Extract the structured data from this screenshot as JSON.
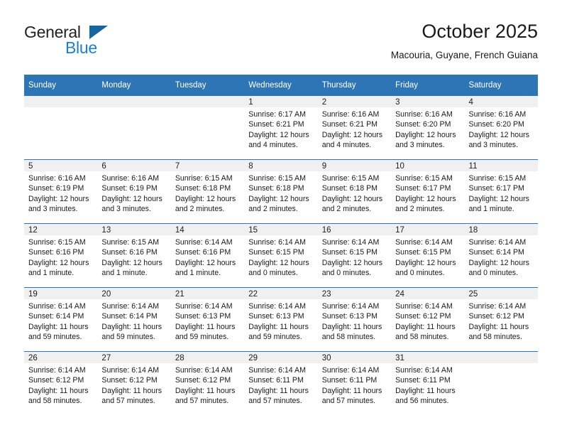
{
  "logo": {
    "primary_text": "General",
    "secondary_text": "Blue",
    "primary_color": "#231f20",
    "secondary_color": "#1b7fd4",
    "triangle_color": "#15659f"
  },
  "header": {
    "title": "October 2025",
    "subtitle": "Macouria, Guyane, French Guiana"
  },
  "theme": {
    "header_bg": "#2e75b6",
    "header_text": "#ffffff",
    "daynum_band_bg": "#f0f0f0",
    "grid_line": "#2e75b6"
  },
  "calendar": {
    "weekday_headers": [
      "Sunday",
      "Monday",
      "Tuesday",
      "Wednesday",
      "Thursday",
      "Friday",
      "Saturday"
    ],
    "weeks": [
      [
        {
          "day": "",
          "empty": true
        },
        {
          "day": "",
          "empty": true
        },
        {
          "day": "",
          "empty": true
        },
        {
          "day": "1",
          "sunrise": "Sunrise: 6:17 AM",
          "sunset": "Sunset: 6:21 PM",
          "daylight_line1": "Daylight: 12 hours",
          "daylight_line2": "and 4 minutes."
        },
        {
          "day": "2",
          "sunrise": "Sunrise: 6:16 AM",
          "sunset": "Sunset: 6:21 PM",
          "daylight_line1": "Daylight: 12 hours",
          "daylight_line2": "and 4 minutes."
        },
        {
          "day": "3",
          "sunrise": "Sunrise: 6:16 AM",
          "sunset": "Sunset: 6:20 PM",
          "daylight_line1": "Daylight: 12 hours",
          "daylight_line2": "and 3 minutes."
        },
        {
          "day": "4",
          "sunrise": "Sunrise: 6:16 AM",
          "sunset": "Sunset: 6:20 PM",
          "daylight_line1": "Daylight: 12 hours",
          "daylight_line2": "and 3 minutes."
        }
      ],
      [
        {
          "day": "5",
          "sunrise": "Sunrise: 6:16 AM",
          "sunset": "Sunset: 6:19 PM",
          "daylight_line1": "Daylight: 12 hours",
          "daylight_line2": "and 3 minutes."
        },
        {
          "day": "6",
          "sunrise": "Sunrise: 6:16 AM",
          "sunset": "Sunset: 6:19 PM",
          "daylight_line1": "Daylight: 12 hours",
          "daylight_line2": "and 3 minutes."
        },
        {
          "day": "7",
          "sunrise": "Sunrise: 6:15 AM",
          "sunset": "Sunset: 6:18 PM",
          "daylight_line1": "Daylight: 12 hours",
          "daylight_line2": "and 2 minutes."
        },
        {
          "day": "8",
          "sunrise": "Sunrise: 6:15 AM",
          "sunset": "Sunset: 6:18 PM",
          "daylight_line1": "Daylight: 12 hours",
          "daylight_line2": "and 2 minutes."
        },
        {
          "day": "9",
          "sunrise": "Sunrise: 6:15 AM",
          "sunset": "Sunset: 6:18 PM",
          "daylight_line1": "Daylight: 12 hours",
          "daylight_line2": "and 2 minutes."
        },
        {
          "day": "10",
          "sunrise": "Sunrise: 6:15 AM",
          "sunset": "Sunset: 6:17 PM",
          "daylight_line1": "Daylight: 12 hours",
          "daylight_line2": "and 2 minutes."
        },
        {
          "day": "11",
          "sunrise": "Sunrise: 6:15 AM",
          "sunset": "Sunset: 6:17 PM",
          "daylight_line1": "Daylight: 12 hours",
          "daylight_line2": "and 1 minute."
        }
      ],
      [
        {
          "day": "12",
          "sunrise": "Sunrise: 6:15 AM",
          "sunset": "Sunset: 6:16 PM",
          "daylight_line1": "Daylight: 12 hours",
          "daylight_line2": "and 1 minute."
        },
        {
          "day": "13",
          "sunrise": "Sunrise: 6:15 AM",
          "sunset": "Sunset: 6:16 PM",
          "daylight_line1": "Daylight: 12 hours",
          "daylight_line2": "and 1 minute."
        },
        {
          "day": "14",
          "sunrise": "Sunrise: 6:14 AM",
          "sunset": "Sunset: 6:16 PM",
          "daylight_line1": "Daylight: 12 hours",
          "daylight_line2": "and 1 minute."
        },
        {
          "day": "15",
          "sunrise": "Sunrise: 6:14 AM",
          "sunset": "Sunset: 6:15 PM",
          "daylight_line1": "Daylight: 12 hours",
          "daylight_line2": "and 0 minutes."
        },
        {
          "day": "16",
          "sunrise": "Sunrise: 6:14 AM",
          "sunset": "Sunset: 6:15 PM",
          "daylight_line1": "Daylight: 12 hours",
          "daylight_line2": "and 0 minutes."
        },
        {
          "day": "17",
          "sunrise": "Sunrise: 6:14 AM",
          "sunset": "Sunset: 6:15 PM",
          "daylight_line1": "Daylight: 12 hours",
          "daylight_line2": "and 0 minutes."
        },
        {
          "day": "18",
          "sunrise": "Sunrise: 6:14 AM",
          "sunset": "Sunset: 6:14 PM",
          "daylight_line1": "Daylight: 12 hours",
          "daylight_line2": "and 0 minutes."
        }
      ],
      [
        {
          "day": "19",
          "sunrise": "Sunrise: 6:14 AM",
          "sunset": "Sunset: 6:14 PM",
          "daylight_line1": "Daylight: 11 hours",
          "daylight_line2": "and 59 minutes."
        },
        {
          "day": "20",
          "sunrise": "Sunrise: 6:14 AM",
          "sunset": "Sunset: 6:14 PM",
          "daylight_line1": "Daylight: 11 hours",
          "daylight_line2": "and 59 minutes."
        },
        {
          "day": "21",
          "sunrise": "Sunrise: 6:14 AM",
          "sunset": "Sunset: 6:13 PM",
          "daylight_line1": "Daylight: 11 hours",
          "daylight_line2": "and 59 minutes."
        },
        {
          "day": "22",
          "sunrise": "Sunrise: 6:14 AM",
          "sunset": "Sunset: 6:13 PM",
          "daylight_line1": "Daylight: 11 hours",
          "daylight_line2": "and 59 minutes."
        },
        {
          "day": "23",
          "sunrise": "Sunrise: 6:14 AM",
          "sunset": "Sunset: 6:13 PM",
          "daylight_line1": "Daylight: 11 hours",
          "daylight_line2": "and 58 minutes."
        },
        {
          "day": "24",
          "sunrise": "Sunrise: 6:14 AM",
          "sunset": "Sunset: 6:12 PM",
          "daylight_line1": "Daylight: 11 hours",
          "daylight_line2": "and 58 minutes."
        },
        {
          "day": "25",
          "sunrise": "Sunrise: 6:14 AM",
          "sunset": "Sunset: 6:12 PM",
          "daylight_line1": "Daylight: 11 hours",
          "daylight_line2": "and 58 minutes."
        }
      ],
      [
        {
          "day": "26",
          "sunrise": "Sunrise: 6:14 AM",
          "sunset": "Sunset: 6:12 PM",
          "daylight_line1": "Daylight: 11 hours",
          "daylight_line2": "and 58 minutes."
        },
        {
          "day": "27",
          "sunrise": "Sunrise: 6:14 AM",
          "sunset": "Sunset: 6:12 PM",
          "daylight_line1": "Daylight: 11 hours",
          "daylight_line2": "and 57 minutes."
        },
        {
          "day": "28",
          "sunrise": "Sunrise: 6:14 AM",
          "sunset": "Sunset: 6:12 PM",
          "daylight_line1": "Daylight: 11 hours",
          "daylight_line2": "and 57 minutes."
        },
        {
          "day": "29",
          "sunrise": "Sunrise: 6:14 AM",
          "sunset": "Sunset: 6:11 PM",
          "daylight_line1": "Daylight: 11 hours",
          "daylight_line2": "and 57 minutes."
        },
        {
          "day": "30",
          "sunrise": "Sunrise: 6:14 AM",
          "sunset": "Sunset: 6:11 PM",
          "daylight_line1": "Daylight: 11 hours",
          "daylight_line2": "and 57 minutes."
        },
        {
          "day": "31",
          "sunrise": "Sunrise: 6:14 AM",
          "sunset": "Sunset: 6:11 PM",
          "daylight_line1": "Daylight: 11 hours",
          "daylight_line2": "and 56 minutes."
        },
        {
          "day": "",
          "empty": true
        }
      ]
    ]
  }
}
